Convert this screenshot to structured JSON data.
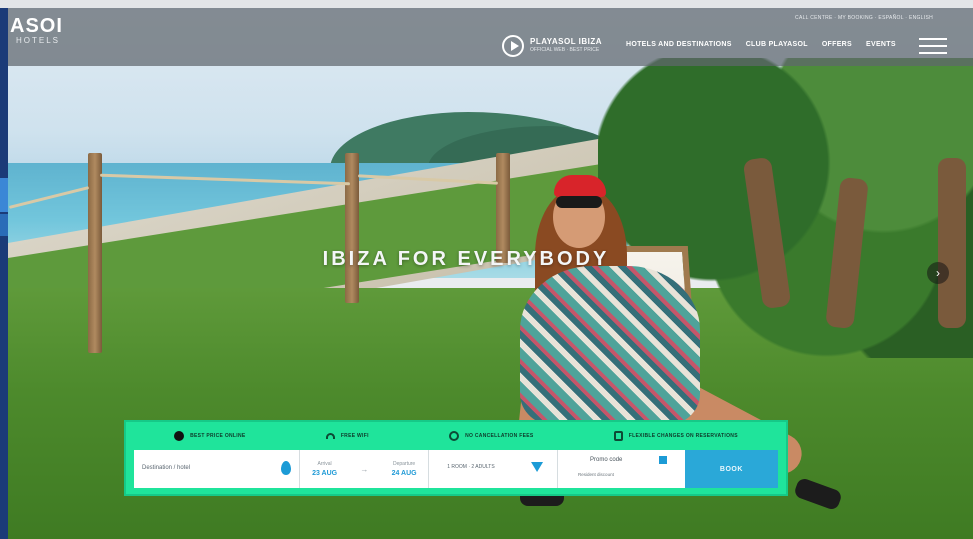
{
  "header": {
    "logo_main": "ASOI",
    "logo_sub": "HOTELS",
    "brand_name": "PLAYASOL IBIZA",
    "brand_tag": "OFFICIAL WEB · BEST PRICE",
    "top_links": "CALL CENTRE · MY BOOKING · ESPAÑOL · ENGLISH",
    "menu": [
      "HOTELS AND DESTINATIONS",
      "CLUB PLAYASOL",
      "OFFERS",
      "EVENTS"
    ]
  },
  "hero": {
    "headline": "IBIZA FOR EVERYBODY",
    "next_arrow": "›"
  },
  "booking": {
    "benefits": [
      {
        "label": "BEST PRICE ONLINE",
        "icon": "badge-icon"
      },
      {
        "label": "FREE WIFI",
        "icon": "wifi-icon"
      },
      {
        "label": "NO CANCELLATION FEES",
        "icon": "globe-icon"
      },
      {
        "label": "FLEXIBLE CHANGES ON RESERVATIONS",
        "icon": "document-icon"
      }
    ],
    "destination_placeholder": "Destination / hotel",
    "checkin_label": "Arrival",
    "checkin_value": "23 AUG",
    "checkout_label": "Departure",
    "checkout_value": "24 AUG",
    "date_separator": "→",
    "guests_text": "1 ROOM · 2 ADULTS",
    "promo_label": "Promo code",
    "promo_sub": "Resident discount",
    "book_label": "BOOK"
  },
  "colors": {
    "booking_bg": "#1fe49b",
    "accent": "#1c9bd6",
    "nav_bg": "#5f666e"
  }
}
